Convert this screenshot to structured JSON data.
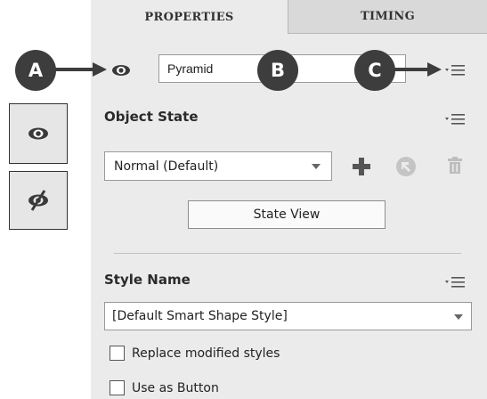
{
  "tabs": [
    {
      "label": "PROPERTIES",
      "active": true
    },
    {
      "label": "TIMING",
      "active": false
    }
  ],
  "name_field": {
    "value": "Pyramid"
  },
  "object_state": {
    "title": "Object State",
    "dropdown_value": "Normal (Default)",
    "state_view_button": "State View"
  },
  "style": {
    "title": "Style Name",
    "dropdown_value": "[Default Smart Shape Style]"
  },
  "checkboxes": [
    {
      "label": "Replace modified styles",
      "checked": false
    },
    {
      "label": "Use as Button",
      "checked": false
    }
  ],
  "callouts": {
    "a": "A",
    "b": "B",
    "c": "C"
  },
  "icons": [
    "eye-icon",
    "panel-menu-icon",
    "dropdown-arrow-icon",
    "add-state-icon",
    "reset-state-icon",
    "delete-state-icon",
    "eye-hidden-icon"
  ],
  "colors": {
    "panel_bg": "#ebebeb",
    "inactive_tab": "#d9d9d9",
    "callout_fill": "#3d3d3d",
    "add_icon": "#555555",
    "disabled_icon": "#bdbdbd"
  }
}
